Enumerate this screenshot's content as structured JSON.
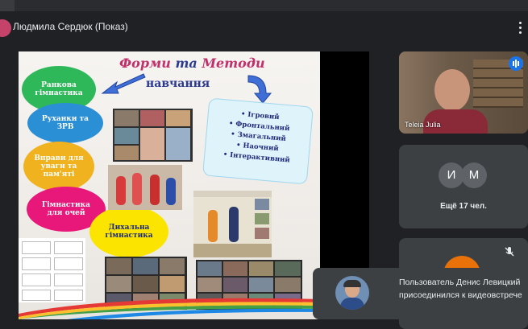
{
  "presenter": {
    "label": "Людмила Сердюк (Показ)",
    "avatar_color": "#c5426b"
  },
  "slide": {
    "title_part1": "Форми",
    "title_part2": " та ",
    "title_part3": "Методи",
    "title_line2": "навчання",
    "forms": [
      "Ранкова\nгімнастика",
      "Руханки та\nЗРВ",
      "Вправи для\nуваги та\nпам'яті",
      "Гімнастика\nдля очей",
      "Дихальна\nгімнастика"
    ],
    "methods": [
      "Ігровий",
      "Фронтальний",
      "Змагальний",
      "Наочний",
      "Інтерактивний"
    ]
  },
  "participants": {
    "speaker_name": "Teleia Julia",
    "avatars": [
      {
        "initial": "И",
        "color": "#5f6368"
      },
      {
        "initial": "М",
        "color": "#5f6368"
      }
    ],
    "more_label": "Ещё 17 чел."
  },
  "toast": {
    "message": "Пользователь Денис Левицкий присоединился к видеовстрече"
  },
  "colors": {
    "accent": "#1a73e8",
    "background": "#202124",
    "tile": "#3c4043"
  }
}
